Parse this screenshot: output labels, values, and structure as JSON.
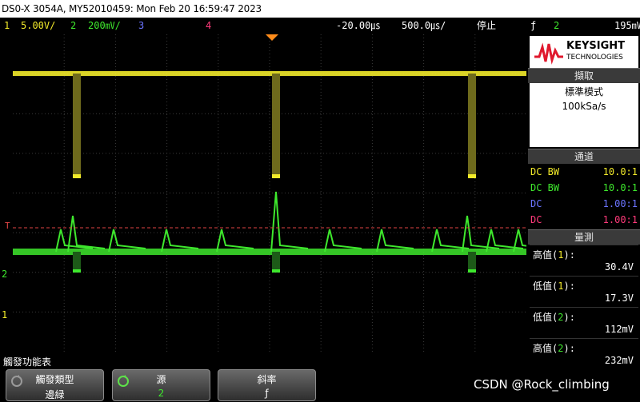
{
  "title": "DS0-X 3054A, MY52010459: Mon Feb 20 16:59:47 2023",
  "status": {
    "ch1": {
      "num": "1",
      "scale": "5.00V/",
      "color": "#f2ea2a"
    },
    "ch2": {
      "num": "2",
      "scale": "200㎷/",
      "color": "#3ee82d"
    },
    "ch3": {
      "num": "3",
      "color": "#6b74ff"
    },
    "ch4": {
      "num": "4",
      "color": "#ff3a7a"
    },
    "delay": "-20.00㎲",
    "timebase": "500.0㎲/",
    "run_state": "停止",
    "trigger_icon": "ƒ",
    "trigger_source": "2",
    "trigger_level": "195㎷"
  },
  "panel": {
    "logo_text_1": "KEYSIGHT",
    "logo_text_2": "TECHNOLOGIES",
    "acquire_title": "擷取",
    "acquire_mode": "標準模式",
    "sample_rate": "100kSa/s",
    "channels_title": "通道",
    "channels": [
      {
        "coupling": "DC BW",
        "probe": "10.0:1",
        "color": "#f2ea2a"
      },
      {
        "coupling": "DC BW",
        "probe": "10.0:1",
        "color": "#3ee82d"
      },
      {
        "coupling": "DC",
        "probe": "1.00:1",
        "color": "#6b74ff"
      },
      {
        "coupling": "DC",
        "probe": "1.00:1",
        "color": "#ff3a7a"
      }
    ],
    "measure_title": "量測",
    "measurements": [
      {
        "label": "高值",
        "ch": "1",
        "value": "30.4V"
      },
      {
        "label": "低值",
        "ch": "1",
        "value": "17.3V"
      },
      {
        "label": "低值",
        "ch": "2",
        "value": "112mV"
      },
      {
        "label": "高值",
        "ch": "2",
        "value": "232mV"
      }
    ]
  },
  "markers": {
    "trig_level": "T",
    "ch2_ref": "2",
    "ch1_ref": "1"
  },
  "softkey_menu_title": "觸發功能表",
  "softkeys": [
    {
      "top": "觸發類型",
      "bottom": "邊緑"
    },
    {
      "top": "源",
      "bottom": "2"
    },
    {
      "top": "斜率",
      "bottom": "ƒ"
    }
  ],
  "watermark": "CSDN @Rock_climbing"
}
